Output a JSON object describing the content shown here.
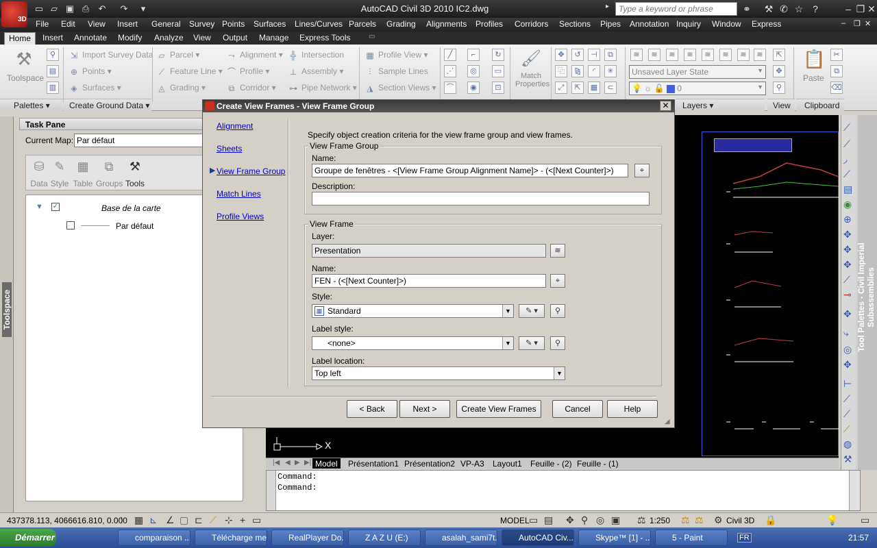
{
  "window": {
    "title": "AutoCAD Civil 3D 2010    IC2.dwg",
    "logo_text": "3D",
    "search_placeholder": "Type a keyword or phrase"
  },
  "menubar": [
    "File",
    "Edit",
    "View",
    "Insert",
    "General",
    "Survey",
    "Points",
    "Surfaces",
    "Lines/Curves",
    "Parcels",
    "Grading",
    "Alignments",
    "Profiles",
    "Corridors",
    "Sections",
    "Pipes",
    "Annotation",
    "Inquiry",
    "Window",
    "Express"
  ],
  "ribbon_tabs": [
    "Home",
    "Insert",
    "Annotate",
    "Modify",
    "Analyze",
    "View",
    "Output",
    "Manage",
    "Express Tools"
  ],
  "ribbon": {
    "toolspace": "Toolspace",
    "import_survey": "Import Survey Data",
    "points": "Points",
    "surfaces": "Surfaces",
    "parcel": "Parcel",
    "feature_line": "Feature Line",
    "grading": "Grading",
    "alignment": "Alignment",
    "profile": "Profile",
    "corridor": "Corridor",
    "intersection": "Intersection",
    "assembly": "Assembly",
    "pipe_network": "Pipe Network",
    "profile_view": "Profile View",
    "sample_lines": "Sample Lines",
    "section_views": "Section Views",
    "match_properties": "Match Properties",
    "layer_state": "Unsaved Layer State",
    "layer_current": "0",
    "paste": "Paste",
    "panel_palettes": "Palettes",
    "panel_create_ground": "Create Ground Data",
    "panel_layers": "Layers",
    "panel_view": "View",
    "panel_clipboard": "Clipboard"
  },
  "taskpane": {
    "title": "Task Pane",
    "current_map_label": "Current Map:",
    "current_map_value": "Par défaut",
    "tabs": [
      "Data",
      "Style",
      "Table",
      "Groups",
      "Tools"
    ],
    "tree_root": "Base de la carte",
    "tree_child": "Par défaut",
    "side_label": "Toolspace"
  },
  "dialog": {
    "title": "Create View Frames - View Frame Group",
    "nav": [
      "Alignment",
      "Sheets",
      "View Frame Group",
      "Match Lines",
      "Profile Views"
    ],
    "intro": "Specify object creation criteria for the view frame group and view frames.",
    "vfg": {
      "title": "View Frame Group",
      "name_label": "Name:",
      "name_value": "Groupe de fenêtres - <[View Frame Group Alignment Name]> - (<[Next Counter]>)",
      "desc_label": "Description:",
      "desc_value": ""
    },
    "vf": {
      "title": "View Frame",
      "layer_label": "Layer:",
      "layer_value": "Presentation",
      "name_label": "Name:",
      "name_value": "FEN - (<[Next Counter]>)",
      "style_label": "Style:",
      "style_value": "Standard",
      "label_style_label": "Label style:",
      "label_style_value": "<none>",
      "label_location_label": "Label location:",
      "label_location_value": "Top left"
    },
    "buttons": {
      "back": "< Back",
      "next": "Next >",
      "create": "Create View Frames",
      "cancel": "Cancel",
      "help": "Help"
    }
  },
  "drawing": {
    "axis_label": "X"
  },
  "layout_tabs": [
    "Model",
    "Présentation1",
    "Présentation2",
    "VP-A3",
    "Layout1",
    "Feuille - (2)",
    "Feuille - (1)"
  ],
  "command_lines": [
    "Command:",
    "Command:"
  ],
  "right_palette_label": "Tool Palettes - Civil Imperial Subassemblies",
  "statusbar": {
    "coords": "437378.113, 4066616.810, 0.000",
    "space": "MODEL",
    "scale": "1:250",
    "workspace": "Civil 3D"
  },
  "taskbar": {
    "start": "Démarrer",
    "tasks": [
      "comparaison ...",
      "Télécharge me...",
      "RealPlayer Do...",
      "Z A Z U (E:)",
      "asalah_sami7t...",
      "AutoCAD Civ...",
      "Skype™ [1] - ...",
      "5 - Paint"
    ],
    "lang": "FR",
    "clock": "21:57"
  }
}
